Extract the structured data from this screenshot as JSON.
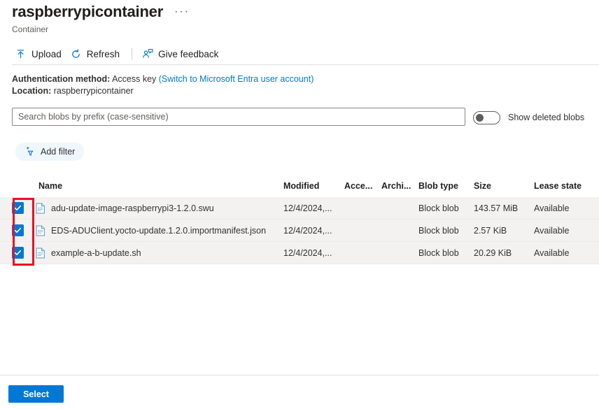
{
  "header": {
    "title": "raspberrypicontainer",
    "subtitle": "Container",
    "more_menu": "···"
  },
  "toolbar": {
    "upload_label": "Upload",
    "refresh_label": "Refresh",
    "feedback_label": "Give feedback"
  },
  "info": {
    "auth_label": "Authentication method:",
    "auth_value": "Access key",
    "auth_switch_link": "(Switch to Microsoft Entra user account)",
    "location_label": "Location:",
    "location_value": "raspberrypicontainer"
  },
  "search": {
    "placeholder": "Search blobs by prefix (case-sensitive)",
    "value": ""
  },
  "show_deleted": {
    "label": "Show deleted blobs",
    "state": "off"
  },
  "filter": {
    "add_filter_label": "Add filter"
  },
  "table": {
    "columns": [
      {
        "key": "name",
        "label": "Name"
      },
      {
        "key": "mod",
        "label": "Modified"
      },
      {
        "key": "acc",
        "label": "Acce..."
      },
      {
        "key": "arc",
        "label": "Archi..."
      },
      {
        "key": "type",
        "label": "Blob type"
      },
      {
        "key": "size",
        "label": "Size"
      },
      {
        "key": "lease",
        "label": "Lease state"
      }
    ],
    "rows": [
      {
        "selected": true,
        "name": "adu-update-image-raspberrypi3-1.2.0.swu",
        "modified": "12/4/2024,...",
        "access_tier": "",
        "archive_status": "",
        "blob_type": "Block blob",
        "size": "143.57 MiB",
        "lease_state": "Available"
      },
      {
        "selected": true,
        "name": "EDS-ADUClient.yocto-update.1.2.0.importmanifest.json",
        "modified": "12/4/2024,...",
        "access_tier": "",
        "archive_status": "",
        "blob_type": "Block blob",
        "size": "2.57 KiB",
        "lease_state": "Available"
      },
      {
        "selected": true,
        "name": "example-a-b-update.sh",
        "modified": "12/4/2024,...",
        "access_tier": "",
        "archive_status": "",
        "blob_type": "Block blob",
        "size": "20.29 KiB",
        "lease_state": "Available"
      }
    ]
  },
  "footer": {
    "select_label": "Select"
  },
  "colors": {
    "accent": "#0078d4",
    "annotation": "#e81123",
    "row_background": "#f3f2f1",
    "filter_pill": "#eff6fc"
  }
}
